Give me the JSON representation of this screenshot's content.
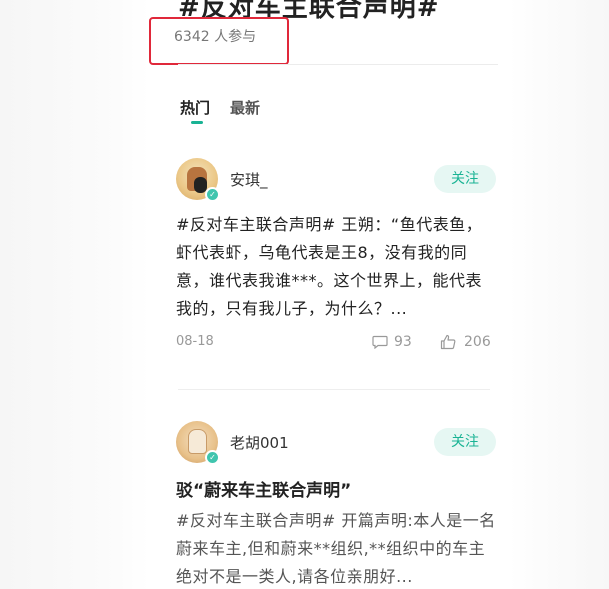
{
  "topic": {
    "title": "#反对车主联合声明#",
    "participants": "6342 人参与"
  },
  "tabs": [
    {
      "label": "热门",
      "active": true
    },
    {
      "label": "最新",
      "active": false
    }
  ],
  "posts": [
    {
      "username": "安琪_",
      "follow_label": "关注",
      "content": "#反对车主联合声明# 王朔：“鱼代表鱼，虾代表虾，乌龟代表是王8，没有我的同意，谁代表我谁***。这个世界上，能代表我的，只有我儿子，为什么？...",
      "date": "08-18",
      "comments": "93",
      "likes": "206"
    },
    {
      "username": "老胡001",
      "follow_label": "关注",
      "title": "驳“蔚来车主联合声明”",
      "content": "#反对车主联合声明# 开篇声明:本人是一名蔚来车主,但和蔚来**组织,**组织中的车主绝对不是一类人,请各位亲朋好..."
    }
  ],
  "colors": {
    "accent": "#19b394",
    "highlight_box": "#e0283a"
  },
  "icons": {
    "comment": "comment-icon",
    "like": "thumbs-up-icon",
    "verified": "verified-badge-icon"
  }
}
